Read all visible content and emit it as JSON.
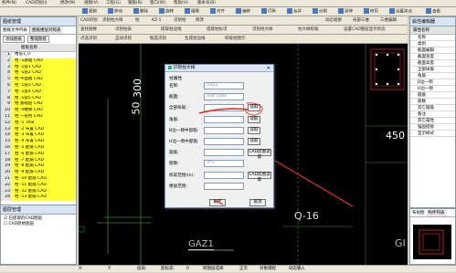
{
  "menubar": {
    "items": [
      "构件(N)",
      "CAD识别(I)",
      "修改(M)",
      "视图(V)",
      "工程(G)",
      "钢筋(B)",
      "窗口(W)",
      "帮助(H)",
      "版本号(B)"
    ]
  },
  "toolbar1": [
    "复制",
    "移动",
    "删除",
    "旋转",
    "镜像",
    "对齐",
    "偏移",
    "打断",
    "合并",
    "分割",
    "延伸",
    "修剪",
    "设置夹点",
    "查看"
  ],
  "toolbar2": [
    "CAD识别",
    "识别柱大样",
    "柱",
    "KZ-1",
    "识别柱",
    "修改",
    "动态观察",
    "局部三维",
    "三维编辑"
  ],
  "toolbar3": [
    "查找替换",
    "识别柱表",
    "提取柱边线",
    "提取柱标识",
    "识别柱大样",
    "柱大样校核",
    "设置CAD图层显示状态"
  ],
  "toolbar4": [
    "点选识别",
    "自动识别",
    "框选识别",
    "生成柱边线",
    "校核柱图元"
  ],
  "left_panel": {
    "title": "图纸管理",
    "tabs": [
      "图纸文件列表",
      "图纸楼层对照表"
    ],
    "buttons": [
      "添加图纸",
      "整理图纸"
    ],
    "column": "图纸名称",
    "rows": [
      {
        "n": "1",
        "text": "楼层1_0",
        "hl": false
      },
      {
        "n": "2",
        "text": "柱 -1基础 CAD",
        "hl": true
      },
      {
        "n": "3",
        "text": "柱 -1层1 CAD",
        "hl": true
      },
      {
        "n": "4",
        "text": "柱 -1层2 CAD",
        "hl": true
      },
      {
        "n": "5",
        "text": "柱 平面图 CAD",
        "hl": true
      },
      {
        "n": "6",
        "text": "柱 -1层3 CAD",
        "hl": true
      },
      {
        "n": "7",
        "text": "柱 -1层4 CAD",
        "hl": true
      },
      {
        "n": "8",
        "text": "柱 -1层5 CAD",
        "hl": true
      },
      {
        "n": "9",
        "text": "柱 基础层 CAD",
        "hl": true
      },
      {
        "n": "10",
        "text": "柱 -4楼梯 CAD",
        "hl": true
      },
      {
        "n": "11",
        "text": "柱 一层柱 CAD",
        "hl": true
      },
      {
        "n": "12",
        "text": "柱 -1 TASI",
        "hl": true
      },
      {
        "n": "13",
        "text": "柱 -2 布置 CAD",
        "hl": true
      },
      {
        "n": "14",
        "text": "柱 -3 布置 CAD",
        "hl": true
      },
      {
        "n": "15",
        "text": "柱 -4 布置 CAD",
        "hl": true
      },
      {
        "n": "16",
        "text": "柱 -5 配筋 CAD",
        "hl": true
      },
      {
        "n": "17",
        "text": "柱 -6 配筋 CAD",
        "hl": true
      },
      {
        "n": "18",
        "text": "柱 -7 配筋 CAD",
        "hl": true
      },
      {
        "n": "19",
        "text": "柱 -8 配筋 CAD",
        "hl": true
      },
      {
        "n": "20",
        "text": "柱 -9 配筋 CAD",
        "hl": true
      },
      {
        "n": "21",
        "text": "柱 -10 配筋 CAD",
        "hl": true
      },
      {
        "n": "22",
        "text": "柱 -11 配筋 CAD",
        "hl": true
      },
      {
        "n": "23",
        "text": "柱 -12 配筋 CAD",
        "hl": true
      },
      {
        "n": "24",
        "text": "柱 -13 配筋 CAD",
        "hl": true
      }
    ],
    "layer_title": "图层管理",
    "layers": [
      "已提取的CAD图层",
      "CAD原始图层"
    ]
  },
  "dialog": {
    "title": "识别柱大样",
    "section": "柱属性",
    "rows": [
      {
        "label": "名称:",
        "value": "GAZ1",
        "button": ""
      },
      {
        "label": "截面:",
        "value": "400*1000",
        "button": ""
      },
      {
        "label": "全部纵筋:",
        "value": "",
        "button": "读取"
      },
      {
        "label": "角筋:",
        "value": "",
        "button": "读取"
      },
      {
        "label": "B边一侧中部筋:",
        "value": "",
        "button": "读取"
      },
      {
        "label": "H边一侧中部筋:",
        "value": "",
        "button": "读取"
      },
      {
        "label": "箍筋:",
        "value": "",
        "button": "CAD底图读取"
      },
      {
        "label": "肢数:",
        "value": "3*3",
        "button": ""
      },
      {
        "label": "标高范围(m):",
        "value": "",
        "button": "CAD底图读取"
      },
      {
        "label": "楼层范围:",
        "value": "",
        "button": ""
      }
    ],
    "ok": "确定",
    "cancel": "取消"
  },
  "canvas": {
    "dim1": "300",
    "dim2": "50",
    "dim3": "450",
    "label_q16": "Q-16",
    "label_gaz1": "GAZ1",
    "label_gi": "GI"
  },
  "right_panel": {
    "title": "属性编辑器",
    "header": "属性名称",
    "rows": [
      "名称",
      "类别",
      "截面编辑",
      "截面宽度",
      "截面高度",
      "全部纵筋",
      "角筋",
      "B边一侧",
      "H边一侧",
      "箍筋",
      "肢数",
      "其它箍筋",
      "备注",
      "其它属性",
      "锚固搭接",
      "显示样式"
    ],
    "bottom_tabs": [
      "布视图",
      "构件列表"
    ]
  },
  "statusbar": {
    "items": [
      "X:",
      "Y:",
      "层高:",
      "底标高:",
      "0",
      "跨图层选择",
      "正交",
      "对象捕捉",
      "动态输入"
    ]
  },
  "colors": {
    "canvas_bg": "#000000",
    "highlight": "#ffff33",
    "annotation": "#e0322a",
    "cad_line": "#2e8b2e"
  }
}
